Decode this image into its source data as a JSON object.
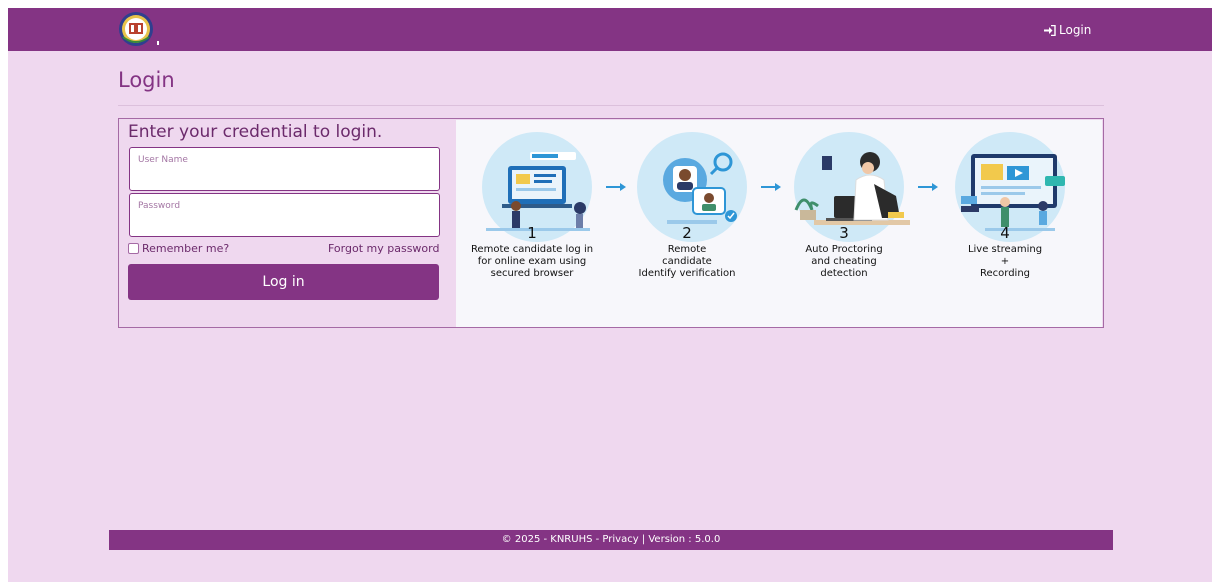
{
  "navbar": {
    "login_label": "Login",
    "background": "#843484",
    "login_icon": "sign-in-icon",
    "logo_icon": "university-emblem-icon"
  },
  "page": {
    "title": "Login"
  },
  "login_form": {
    "heading": "Enter your credential to login.",
    "username_label": "User Name",
    "username_value": "",
    "password_label": "Password",
    "password_value": "",
    "remember_label": "Remember me?",
    "remember_checked": false,
    "forgot_label": "Forgot my password",
    "submit_label": "Log in"
  },
  "banner": {
    "steps": [
      {
        "number": "1",
        "description": "Remote candidate log in\nfor online exam using\nsecured browser",
        "icon": "laptop-exam-icon"
      },
      {
        "number": "2",
        "description": "Remote\ncandidate\nIdentify verification",
        "icon": "identity-verification-icon"
      },
      {
        "number": "3",
        "description": "Auto Proctoring\nand cheating\ndetection",
        "icon": "proctoring-icon"
      },
      {
        "number": "4",
        "description": "Live streaming\n+\nRecording",
        "icon": "live-streaming-icon"
      }
    ],
    "arrow_icon": "arrow-right-icon",
    "accent": "#2e96d6"
  },
  "footer": {
    "copyright": "© 2025 - KNRUHS - ",
    "privacy_label": "Privacy",
    "separator": " | ",
    "version": "Version : 5.0.0"
  },
  "colors": {
    "brand": "#843484",
    "page_background": "#efd8ef"
  }
}
